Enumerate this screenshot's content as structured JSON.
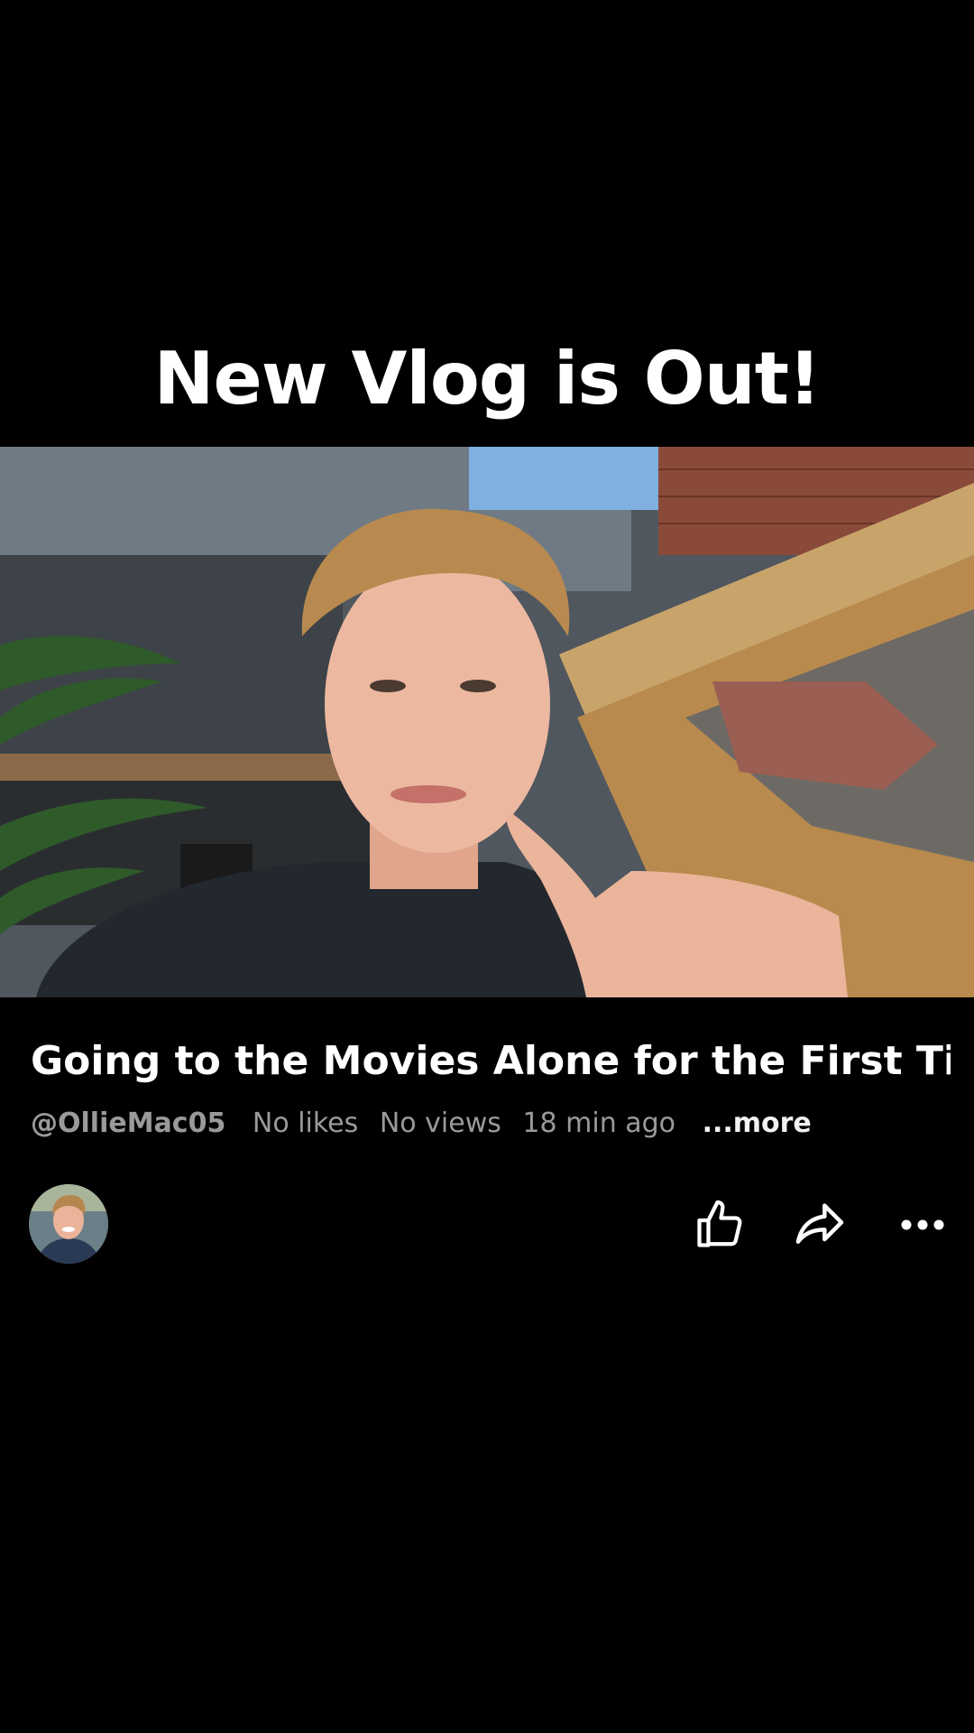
{
  "overlay": {
    "headline": "New Vlog is Out!"
  },
  "player": {
    "progress": 0.028
  },
  "video": {
    "title": "Going to the Movies Alone for the First Ti...",
    "channel": "@OllieMac05",
    "likes": "No likes",
    "views": "No views",
    "time_ago": "18 min ago",
    "more_label": "...more"
  },
  "actions": {
    "icons": [
      "thumbs-up-icon",
      "share-icon",
      "more-options-icon"
    ]
  },
  "colors": {
    "background": "#000000",
    "text_primary": "#ffffff",
    "text_secondary": "#9a9a9a"
  }
}
